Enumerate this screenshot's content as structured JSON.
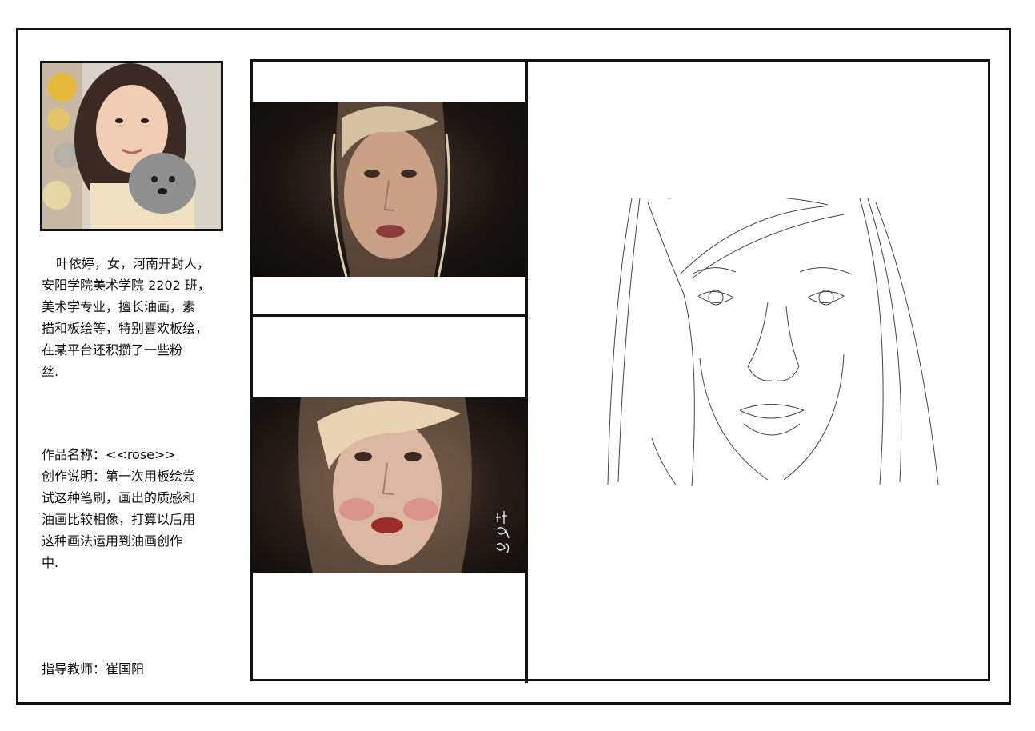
{
  "student": {
    "bio_indent": "",
    "bio_lines": [
      "叶依婷，女，河南开封人，",
      "安阳学院美术学院 2202 班，",
      "美术学专业，擅长油画，素",
      "描和板绘等，特别喜欢板绘，",
      "在某平台还积攒了一些粉",
      "丝."
    ]
  },
  "work": {
    "lines": [
      "作品名称：<<rose>>",
      "创作说明：第一次用板绘尝",
      "试这种笔刷，画出的质感和",
      "油画比较相像，打算以后用",
      "这种画法运用到油画创作",
      "中."
    ]
  },
  "teacher": {
    "line": "指导教师：崔国阳"
  },
  "colors": {
    "frame": "#111111",
    "background": "#ffffff"
  }
}
